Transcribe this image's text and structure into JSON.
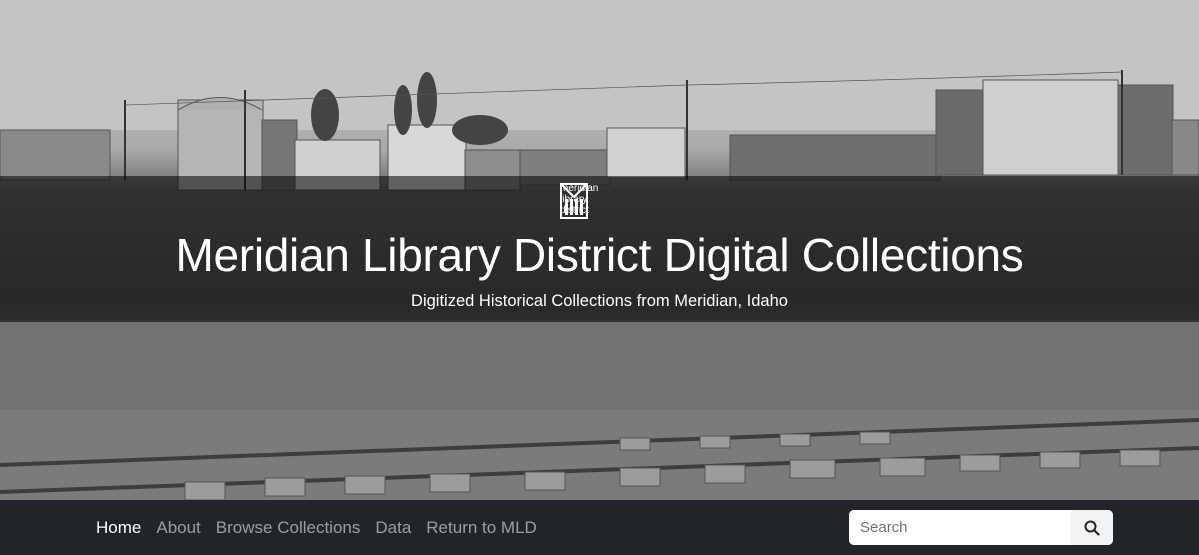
{
  "header": {
    "logo_lines": [
      "meridian",
      "library",
      "district"
    ],
    "title": "Meridian Library District Digital Collections",
    "subtitle": "Digitized Historical Collections from Meridian, Idaho"
  },
  "nav": {
    "items": [
      {
        "label": "Home",
        "active": true
      },
      {
        "label": "About",
        "active": false
      },
      {
        "label": "Browse Collections",
        "active": false
      },
      {
        "label": "Data",
        "active": false
      },
      {
        "label": "Return to MLD",
        "active": false
      }
    ]
  },
  "search": {
    "placeholder": "Search",
    "button_icon": "search-icon"
  },
  "colors": {
    "navbar_bg": "#212529",
    "nav_active": "#ffffff",
    "nav_inactive": "#9a9da0"
  }
}
